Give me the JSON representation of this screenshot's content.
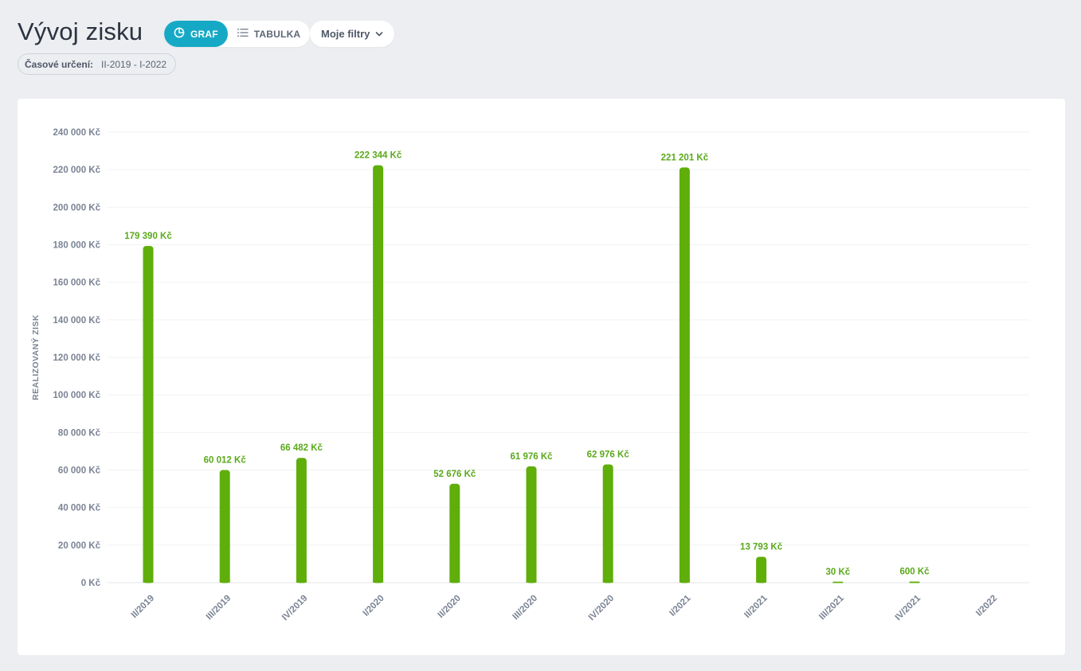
{
  "page": {
    "title": "Vývoj zisku"
  },
  "toolbar": {
    "graph_label": "GRAF",
    "table_label": "TABULKA",
    "filters_label": "Moje filtry"
  },
  "time_filter": {
    "label": "Časové určení:",
    "value": "II-2019 - I-2022"
  },
  "colors": {
    "accent": "#16a9c6",
    "bar": "#5fae0a"
  },
  "chart_data": {
    "type": "bar",
    "ylabel": "REALIZOVANÝ ZISK",
    "ylim": [
      0,
      240000
    ],
    "y_ticks": [
      "0 Kč",
      "20 000 Kč",
      "40 000 Kč",
      "60 000 Kč",
      "80 000 Kč",
      "100 000 Kč",
      "120 000 Kč",
      "140 000 Kč",
      "160 000 Kč",
      "180 000 Kč",
      "200 000 Kč",
      "220 000 Kč",
      "240 000 Kč"
    ],
    "categories": [
      "II/2019",
      "III/2019",
      "IV/2019",
      "I/2020",
      "II/2020",
      "III/2020",
      "IV/2020",
      "I/2021",
      "II/2021",
      "III/2021",
      "IV/2021",
      "I/2022"
    ],
    "values": [
      179390,
      60012,
      66482,
      222344,
      52676,
      61976,
      62976,
      221201,
      13793,
      30,
      600,
      null
    ],
    "value_labels": [
      "179 390 Kč",
      "60 012 Kč",
      "66 482 Kč",
      "222 344 Kč",
      "52 676 Kč",
      "61 976 Kč",
      "62 976 Kč",
      "221 201 Kč",
      "13 793 Kč",
      "30 Kč",
      "600 Kč",
      ""
    ],
    "grid": true,
    "legend": "none"
  }
}
